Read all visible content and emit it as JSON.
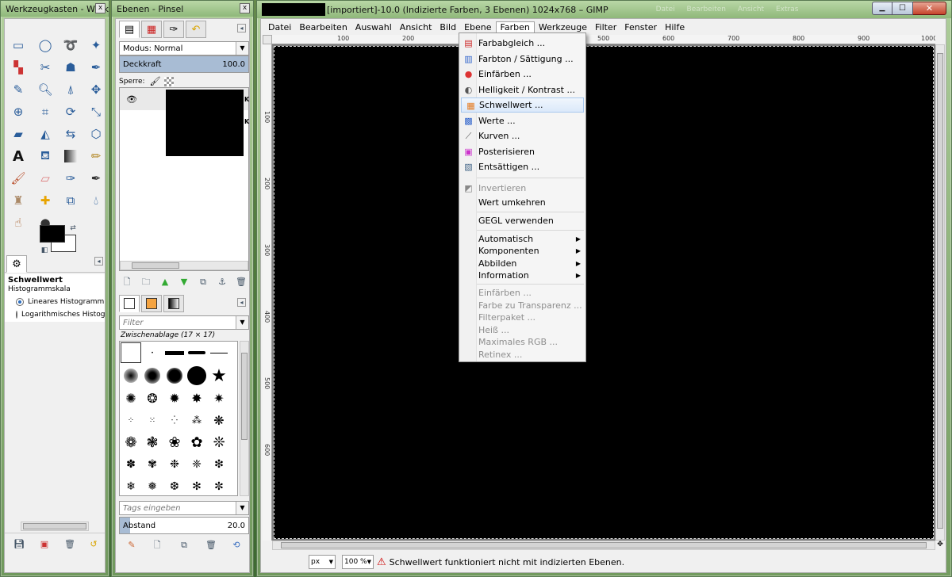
{
  "toolbox": {
    "title": "Werkzeugkasten - Werk...",
    "close_label": "x",
    "tool_options": {
      "tool_name": "Schwellwert",
      "histogram_label": "Histogrammskala",
      "options": [
        "Lineares Histogramm",
        "Logarithmisches Histogram"
      ],
      "selected": 0
    }
  },
  "layers": {
    "title": "Ebenen - Pinsel",
    "close_label": "x",
    "mode_label": "Modus: Normal",
    "opacity_label": "Deckkraft",
    "opacity_value": "100.0",
    "lock_label": "Sperre:",
    "layer_marks": [
      "K",
      "K"
    ],
    "brushes": {
      "filter_placeholder": "Filter",
      "header": "Zwischenablage (17 × 17)",
      "tags_placeholder": "Tags eingeben",
      "spacing_label": "Abstand",
      "spacing_value": "20.0"
    }
  },
  "gimp": {
    "title": "[importiert]-10.0 (Indizierte Farben, 3 Ebenen) 1024x768 – GIMP",
    "faded_title_words": [
      "Datei",
      "Bearbeiten",
      "Ansicht",
      "Extras"
    ],
    "menubar": [
      "Datei",
      "Bearbeiten",
      "Auswahl",
      "Ansicht",
      "Bild",
      "Ebene",
      "Farben",
      "Werkzeuge",
      "Filter",
      "Fenster",
      "Hilfe"
    ],
    "open_menu_index": 6,
    "ruler_h": [
      "100",
      "200",
      "300",
      "400",
      "500",
      "600",
      "700",
      "800",
      "900",
      "1000"
    ],
    "ruler_v": [
      "100",
      "200",
      "300",
      "400",
      "500",
      "600"
    ],
    "unit": "px",
    "zoom": "100 %",
    "status_message": "Schwellwert funktioniert nicht mit indizierten Ebenen."
  },
  "farben_menu": {
    "items": [
      {
        "label": "Farbabgleich ...",
        "icon": "color-balance-icon",
        "disabled": false
      },
      {
        "label": "Farbton / Sättigung ...",
        "icon": "hue-saturation-icon",
        "disabled": false
      },
      {
        "label": "Einfärben ...",
        "icon": "colorize-icon",
        "disabled": false
      },
      {
        "label": "Helligkeit / Kontrast ...",
        "icon": "brightness-contrast-icon",
        "disabled": false
      },
      {
        "label": "Schwellwert ...",
        "icon": "threshold-icon",
        "disabled": false,
        "highlighted": true
      },
      {
        "label": "Werte ...",
        "icon": "levels-icon",
        "disabled": false
      },
      {
        "label": "Kurven ...",
        "icon": "curves-icon",
        "disabled": false
      },
      {
        "label": "Posterisieren",
        "icon": "posterize-icon",
        "disabled": false
      },
      {
        "label": "Entsättigen ...",
        "icon": "desaturate-icon",
        "disabled": false
      },
      {
        "label": "Invertieren",
        "icon": "invert-icon",
        "disabled": true
      },
      {
        "label": "Wert umkehren",
        "icon": "",
        "disabled": false
      },
      {
        "label": "GEGL verwenden",
        "icon": "",
        "disabled": false
      },
      {
        "label": "Automatisch",
        "icon": "",
        "disabled": false,
        "submenu": true
      },
      {
        "label": "Komponenten",
        "icon": "",
        "disabled": false,
        "submenu": true
      },
      {
        "label": "Abbilden",
        "icon": "",
        "disabled": false,
        "submenu": true
      },
      {
        "label": "Information",
        "icon": "",
        "disabled": false,
        "submenu": true
      },
      {
        "label": "Einfärben ...",
        "icon": "",
        "disabled": true
      },
      {
        "label": "Farbe zu Transparenz ...",
        "icon": "",
        "disabled": true
      },
      {
        "label": "Filterpaket ...",
        "icon": "",
        "disabled": true
      },
      {
        "label": "Heiß ...",
        "icon": "",
        "disabled": true
      },
      {
        "label": "Maximales RGB ...",
        "icon": "",
        "disabled": true
      },
      {
        "label": "Retinex ...",
        "icon": "",
        "disabled": true
      }
    ]
  }
}
